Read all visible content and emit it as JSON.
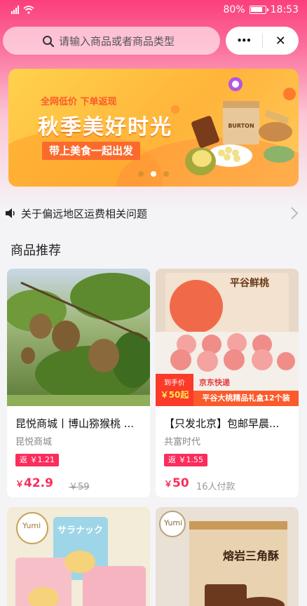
{
  "status_bar": {
    "battery": "80%",
    "time": "18:53"
  },
  "search": {
    "placeholder": "请输入商品或者商品类型"
  },
  "capsule": {
    "more": "•••",
    "close": "✕"
  },
  "banner": {
    "tag": "全网低价  下单返现",
    "title": "秋季美好时光",
    "subtitle": "带上美食一起出发",
    "dots": 3,
    "active_dot": 1
  },
  "notice": {
    "text": "关于偏远地区运费相关问题"
  },
  "section": {
    "title": "商品推荐"
  },
  "products": [
    {
      "name": "昆悦商城丨博山猕猴桃 ...",
      "shop": "昆悦商城",
      "rebate": "返 ￥1.21",
      "price_symbol": "￥",
      "price": "42.9",
      "original_price": "￥59"
    },
    {
      "name": "【只发北京】包邮早晨...",
      "shop": "共富时代",
      "rebate": "返 ￥1.55",
      "price_symbol": "￥",
      "price": "50",
      "paid": "16人付款",
      "image_text": {
        "box_title": "平谷鲜桃",
        "promo_label": "到手价",
        "promo_price": "￥50起",
        "courier": "京东快递",
        "caption": "平谷大桃精品礼盒12个装"
      }
    },
    {
      "image_text": {
        "brand": "Yumi",
        "pack": "サラナック"
      }
    },
    {
      "image_text": {
        "brand": "Yumi",
        "pack": "熔岩三角酥"
      }
    }
  ],
  "colors": {
    "accent": "#fb2d5c",
    "header": "#fb3f7c"
  }
}
